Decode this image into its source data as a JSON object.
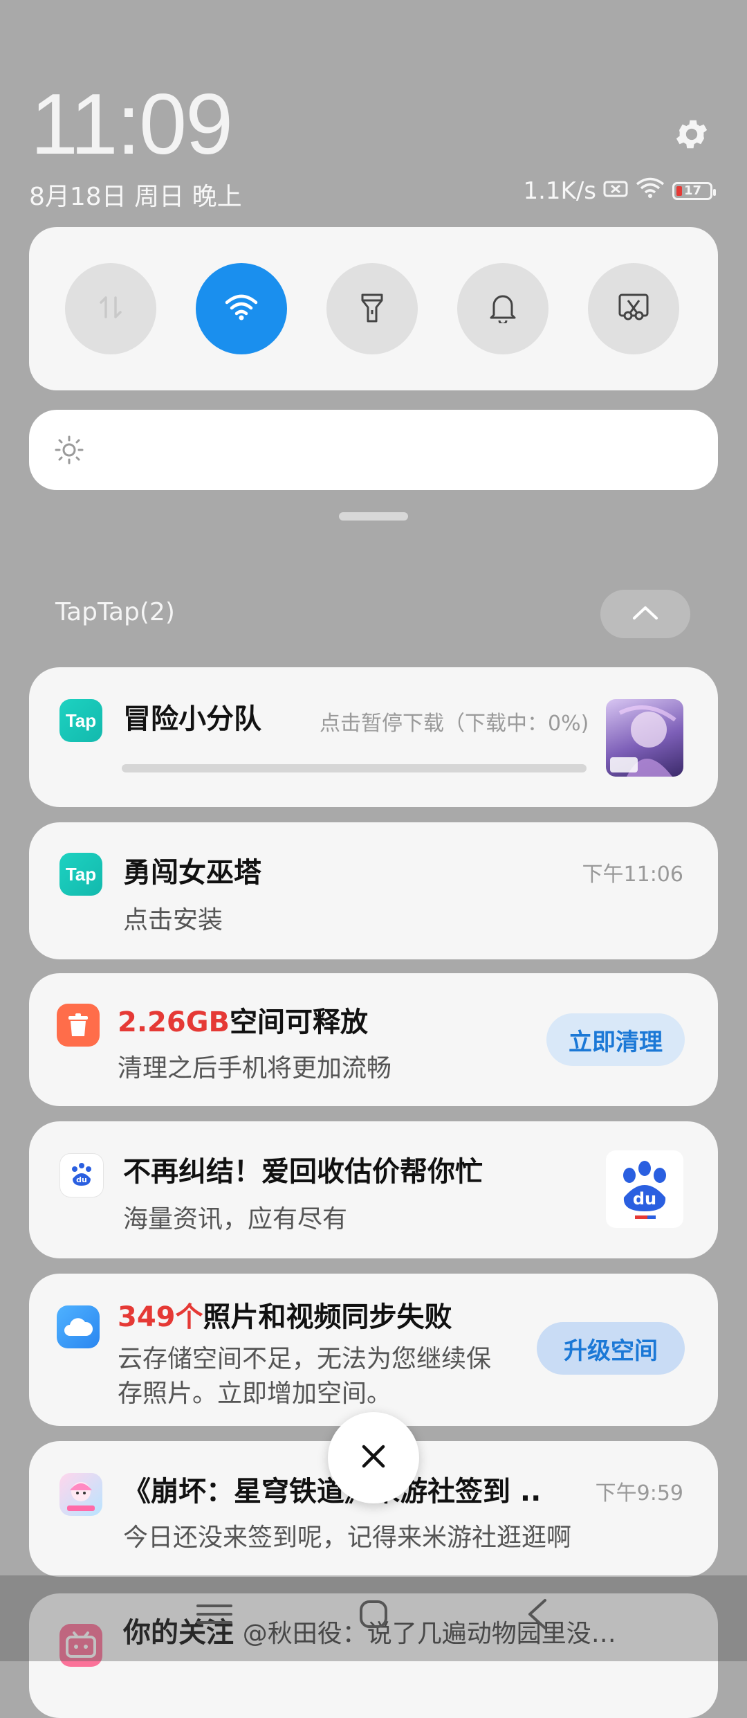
{
  "status_bar": {
    "time": "11:09",
    "date": "8月18日 周日 晚上",
    "net_speed": "1.1K/s",
    "battery_level": "17"
  },
  "quick_settings": {
    "toggles": [
      {
        "name": "data-toggle",
        "icon": "data-arrows-icon",
        "active": false
      },
      {
        "name": "wifi-toggle",
        "icon": "wifi-icon",
        "active": true
      },
      {
        "name": "flashlight-toggle",
        "icon": "flashlight-icon",
        "active": false
      },
      {
        "name": "bell-toggle",
        "icon": "bell-icon",
        "active": false
      },
      {
        "name": "screenshot-toggle",
        "icon": "screenshot-scissors-icon",
        "active": false
      }
    ],
    "active_color": "#1a8fee"
  },
  "notification_group": {
    "title": "TapTap(2)"
  },
  "notifications": [
    {
      "app": "TapTap",
      "title": "冒险小分队",
      "status": "点击暂停下载（下载中：0%)",
      "progress": 0
    },
    {
      "app": "TapTap",
      "title": "勇闯女巫塔",
      "subtitle": "点击安装",
      "time": "下午11:06"
    },
    {
      "app": "cleaner",
      "title_highlight": "2.26GB",
      "title_rest": "空间可释放",
      "subtitle": "清理之后手机将更加流畅",
      "button": "立即清理"
    },
    {
      "app": "baidu",
      "title": "不再纠结！爱回收估价帮你忙",
      "subtitle": "海量资讯，应有尽有",
      "thumb_text": "du"
    },
    {
      "app": "cloud",
      "title_highlight": "349个",
      "title_rest": "照片和视频同步失败",
      "subtitle_line1": "云存储空间不足，无法为您继续保",
      "subtitle_line2": "存照片。立即增加空间。",
      "button": "升级空间"
    },
    {
      "app": "miyoushe",
      "title": "《崩坏：星穹铁道》米游社签到 ..",
      "subtitle": "今日还没来签到呢，记得来米游社逛逛啊",
      "time": "下午9:59"
    },
    {
      "app": "bilibili",
      "title": "你的关注",
      "subtitle": "@秋田役：说了几遍动物园里没…"
    }
  ],
  "colors": {
    "highlight_red": "#e53935",
    "button_blue": "#1b78d6"
  }
}
